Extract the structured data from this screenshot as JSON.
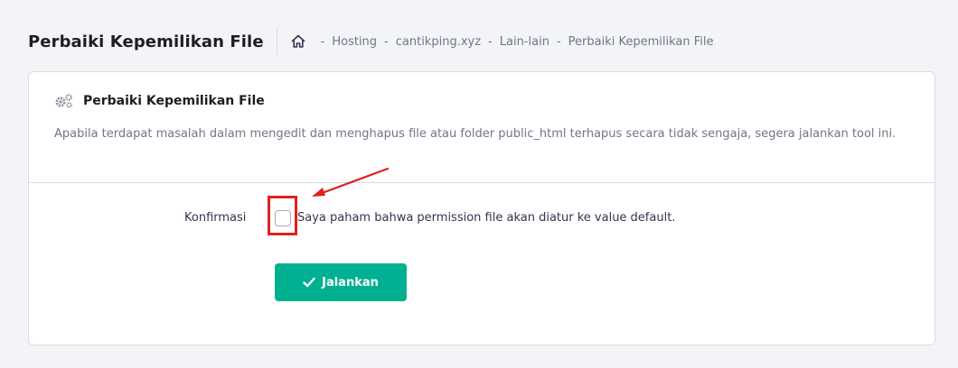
{
  "header": {
    "title": "Perbaiki Kepemilikan File",
    "breadcrumb": {
      "home_icon": "home-icon",
      "separator": "-",
      "items": [
        "Hosting",
        "cantikping.xyz",
        "Lain-lain",
        "Perbaiki Kepemilikan File"
      ]
    }
  },
  "card": {
    "icon": "gears-icon",
    "title": "Perbaiki Kepemilikan File",
    "description": "Apabila terdapat masalah dalam mengedit dan menghapus file atau folder public_html terhapus secara tidak sengaja, segera jalankan tool ini.",
    "form": {
      "label": "Konfirmasi",
      "checkbox_text": "Saya paham bahwa permission file akan diatur ke value default.",
      "checkbox_checked": false
    },
    "button": {
      "label": "Jalankan",
      "icon": "check-icon",
      "color": "#00b090"
    }
  },
  "annotation": {
    "color": "#e0201f"
  }
}
